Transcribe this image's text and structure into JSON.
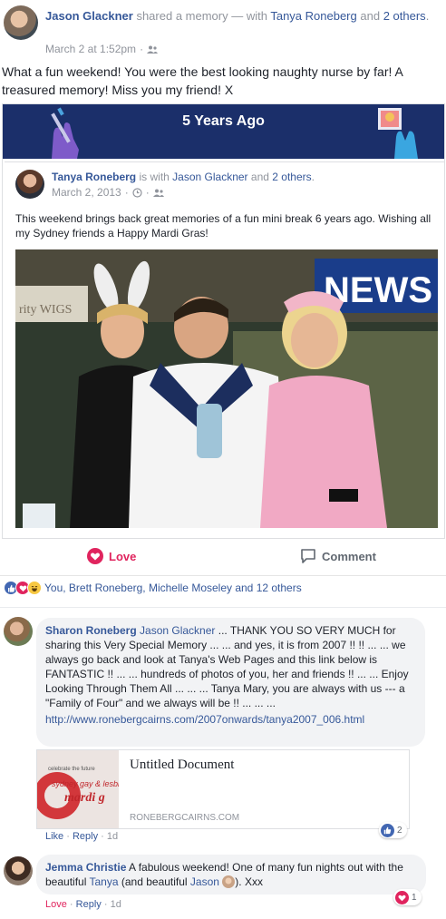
{
  "post": {
    "author": "Jason Glackner",
    "action": "shared a memory — with",
    "tagged": "Tanya Roneberg",
    "and": "and",
    "others": "2 others",
    "period": ".",
    "time": "March 2 at 1:52pm",
    "separator": "·",
    "text": "What a fun weekend! You were the best looking naughty nurse by far! A treasured memory! Miss you my friend! X"
  },
  "memory": {
    "title": "5 Years Ago",
    "shared_post": {
      "author": "Tanya Roneberg",
      "is_with": "is with",
      "tagged": "Jason Glackner",
      "and": "and",
      "others": "2 others",
      "period": ".",
      "date": "March 2, 2013",
      "separator": "·",
      "text": "This weekend brings back great memories of a fun mini break 6 years ago. Wishing all my Sydney friends a Happy Mardi Gras!"
    },
    "photo_signs": {
      "news": "NEWS",
      "wigs": "rity WIGS"
    }
  },
  "actions": {
    "love": "Love",
    "comment": "Comment"
  },
  "reactions": {
    "summary": "You, Brett Roneberg, Michelle Moseley and 12 others"
  },
  "comments": [
    {
      "author": "Sharon Roneberg",
      "mention": "Jason Glackner",
      "text": " ... THANK YOU SO VERY MUCH for sharing this Very Special Memory ... ... and yes, it is from 2007 !! !! ... ... we always go back and look at Tanya's Web Pages and this link below is FANTASTIC !! ... ... hundreds of photos of you, her and friends !! ... ... Enjoy Looking Through Them All ... ... ... Tanya Mary, you are always with us --- a \"Family of Four\" and we always will be !! ... ... ...",
      "url": "http://www.ronebergcairns.com/2007onwards/tanya2007_006.html",
      "link_card": {
        "title": "Untitled Document",
        "domain": "RONEBERGCAIRNS.COM",
        "thumb_text": "celebrate the future sydney gay & lesbian mardi gras"
      },
      "like": "Like",
      "reply": "Reply",
      "sep": "·",
      "age": "1d",
      "reaction_count": "2"
    },
    {
      "author": "Jemma Christie",
      "text_a": " A fabulous weekend! One of many fun nights out with the beautiful ",
      "mention1": "Tanya",
      "text_b": " (and beautiful ",
      "mention2": "Jason",
      "text_c": "). Xxx",
      "love": "Love",
      "reply": "Reply",
      "sep": "·",
      "age": "1d",
      "reaction_count": "1"
    }
  ],
  "colors": {
    "link": "#365899",
    "love": "#e0245e",
    "banner": "#1b2f6a",
    "bubble": "#f2f3f5"
  }
}
